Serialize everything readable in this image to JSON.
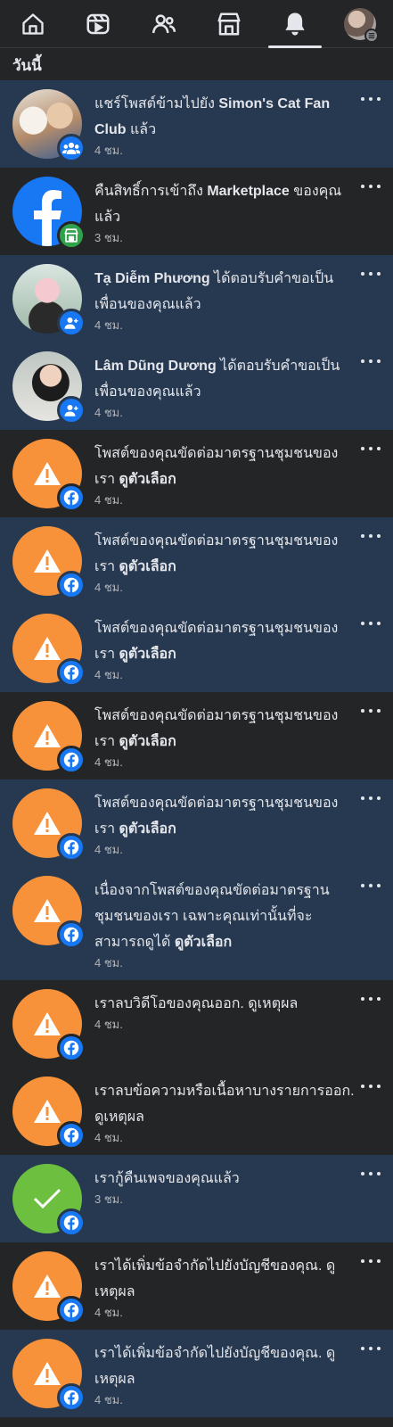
{
  "nav": {
    "items": [
      {
        "name": "home-icon"
      },
      {
        "name": "video-icon"
      },
      {
        "name": "friends-icon"
      },
      {
        "name": "marketplace-icon"
      },
      {
        "name": "bell-icon",
        "active": true
      },
      {
        "name": "profile-avatar"
      }
    ]
  },
  "section": {
    "today": "วันนี้"
  },
  "notifications": [
    {
      "pre": "แชร์โพสต์ข้ามไปยัง ",
      "bold": "Simon's Cat Fan Club",
      "post": " แล้ว",
      "time": "4 ชม.",
      "avatar": "cat",
      "badge": "group",
      "unread": true
    },
    {
      "pre": "คืนสิทธิ์การเข้าถึง ",
      "bold": "Marketplace",
      "post": " ของคุณแล้ว",
      "time": "3 ชม.",
      "avatar": "fb",
      "badge": "shop",
      "unread": false
    },
    {
      "pre": "",
      "bold": "Tạ Diễm Phương",
      "post": " ได้ตอบรับคำขอเป็นเพื่อนของคุณแล้ว",
      "time": "4 ชม.",
      "avatar": "p1",
      "badge": "friend",
      "unread": true
    },
    {
      "pre": "",
      "bold": "Lâm Dũng Dương",
      "post": " ได้ตอบรับคำขอเป็นเพื่อนของคุณแล้ว",
      "time": "4 ชม.",
      "avatar": "p2",
      "badge": "friend",
      "unread": true
    },
    {
      "pre": "โพสต์ของคุณขัดต่อมาตรฐานชุมชนของเรา ",
      "bold": "ดูตัวเลือก",
      "post": "",
      "time": "4 ชม.",
      "avatar": "warn",
      "badge": "fb",
      "unread": false
    },
    {
      "pre": "โพสต์ของคุณขัดต่อมาตรฐานชุมชนของเรา ",
      "bold": "ดูตัวเลือก",
      "post": "",
      "time": "4 ชม.",
      "avatar": "warn",
      "badge": "fb",
      "unread": true
    },
    {
      "pre": "โพสต์ของคุณขัดต่อมาตรฐานชุมชนของเรา ",
      "bold": "ดูตัวเลือก",
      "post": "",
      "time": "4 ชม.",
      "avatar": "warn",
      "badge": "fb",
      "unread": true
    },
    {
      "pre": "โพสต์ของคุณขัดต่อมาตรฐานชุมชนของเรา ",
      "bold": "ดูตัวเลือก",
      "post": "",
      "time": "4 ชม.",
      "avatar": "warn",
      "badge": "fb",
      "unread": false
    },
    {
      "pre": "โพสต์ของคุณขัดต่อมาตรฐานชุมชนของเรา ",
      "bold": "ดูตัวเลือก",
      "post": "",
      "time": "4 ชม.",
      "avatar": "warn",
      "badge": "fb",
      "unread": true
    },
    {
      "pre": "เนื่องจากโพสต์ของคุณขัดต่อมาตรฐานชุมชนของเรา เฉพาะคุณเท่านั้นที่จะสามารถดูได้ ",
      "bold": "ดูตัวเลือก",
      "post": "",
      "time": "4 ชม.",
      "avatar": "warn",
      "badge": "fb",
      "unread": true
    },
    {
      "pre": "เราลบวิดีโอของคุณออก. ดูเหตุผล",
      "bold": "",
      "post": "",
      "time": "4 ชม.",
      "avatar": "warn",
      "badge": "fb",
      "unread": false
    },
    {
      "pre": "เราลบข้อความหรือเนื้อหาบางรายการออก. ดูเหตุผล",
      "bold": "",
      "post": "",
      "time": "4 ชม.",
      "avatar": "warn",
      "badge": "fb",
      "unread": false
    },
    {
      "pre": "เรากู้คืนเพจของคุณแล้ว",
      "bold": "",
      "post": "",
      "time": "3 ชม.",
      "avatar": "check",
      "badge": "fb",
      "unread": true
    },
    {
      "pre": "เราได้เพิ่มข้อจำกัดไปยังบัญชีของคุณ. ดูเหตุผล",
      "bold": "",
      "post": "",
      "time": "4 ชม.",
      "avatar": "warn",
      "badge": "fb",
      "unread": false
    },
    {
      "pre": "เราได้เพิ่มข้อจำกัดไปยังบัญชีของคุณ. ดูเหตุผล",
      "bold": "",
      "post": "",
      "time": "4 ชม.",
      "avatar": "warn",
      "badge": "fb",
      "unread": true
    }
  ],
  "colors": {
    "background": "#242526",
    "unread_background": "#263951",
    "facebook_blue": "#1877f2",
    "warning_orange": "#f7923a",
    "success_green": "#6cbf3f",
    "friend_badge": "#1877f2",
    "group_badge": "#1877f2",
    "shop_badge": "#31a24c"
  }
}
